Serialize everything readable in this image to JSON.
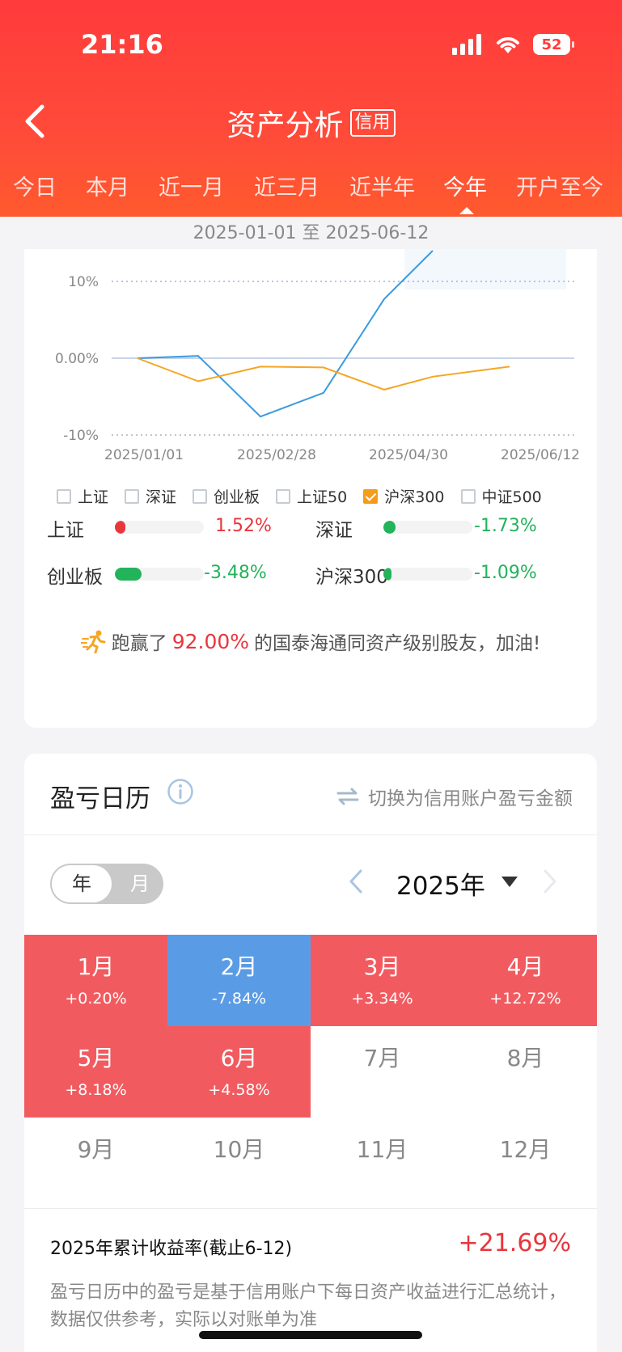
{
  "status": {
    "time": "21:16",
    "battery": "52"
  },
  "nav": {
    "title": "资产分析",
    "badge": "信用",
    "tabs": [
      "今日",
      "本月",
      "近一月",
      "近三月",
      "近半年",
      "今年",
      "开户至今"
    ],
    "active_tab": "今年"
  },
  "date_range": "2025-01-01 至 2025-06-12",
  "chart_data": {
    "type": "line",
    "x": [
      "2025/01/01",
      "2025/02/01",
      "2025/02/28",
      "2025/03/31",
      "2025/04/30",
      "2025/05/31",
      "2025/06/12"
    ],
    "x_tick_labels": [
      "2025/01/01",
      "2025/02/28",
      "2025/04/30",
      "2025/06/12"
    ],
    "y_tick_labels": [
      "10%",
      "0.00%",
      "-10%"
    ],
    "ylim": [
      -10,
      10
    ],
    "series": [
      {
        "color": "#3a9be0",
        "values": [
          0.0,
          0.3,
          -7.6,
          -4.5,
          7.7,
          14.0,
          null
        ]
      },
      {
        "color": "#f5a623",
        "values": [
          0.0,
          -3.0,
          -1.1,
          -1.2,
          -4.1,
          -2.4,
          -1.1
        ]
      }
    ],
    "grid": "dotted",
    "legend": [
      {
        "label": "上证",
        "checked": false
      },
      {
        "label": "深证",
        "checked": false
      },
      {
        "label": "创业板",
        "checked": false
      },
      {
        "label": "上证50",
        "checked": false
      },
      {
        "label": "沪深300",
        "checked": true
      },
      {
        "label": "中证500",
        "checked": false
      }
    ]
  },
  "indices": [
    {
      "name": "上证",
      "value": "1.52%",
      "pct": 12,
      "color": "#e8363d"
    },
    {
      "name": "深证",
      "value": "-1.73%",
      "pct": 14,
      "color": "#22b35b"
    },
    {
      "name": "创业板",
      "value": "-3.48%",
      "pct": 30,
      "color": "#22b35b"
    },
    {
      "name": "沪深300",
      "value": "-1.09%",
      "pct": 9,
      "color": "#22b35b"
    }
  ],
  "beat": {
    "prefix": "跑赢了",
    "pct": "92.00%",
    "suffix": "的国泰海通同资产级别股友，加油!"
  },
  "calendar": {
    "title": "盈亏日历",
    "switch_label": "切换为信用账户盈亏金额",
    "seg_year": "年",
    "seg_month": "月",
    "year": "2025年",
    "months": [
      {
        "name": "1月",
        "value": "+0.20%",
        "state": "pos"
      },
      {
        "name": "2月",
        "value": "-7.84%",
        "state": "neg"
      },
      {
        "name": "3月",
        "value": "+3.34%",
        "state": "pos"
      },
      {
        "name": "4月",
        "value": "+12.72%",
        "state": "pos"
      },
      {
        "name": "5月",
        "value": "+8.18%",
        "state": "pos"
      },
      {
        "name": "6月",
        "value": "+4.58%",
        "state": "pos"
      },
      {
        "name": "7月",
        "value": "",
        "state": "none"
      },
      {
        "name": "8月",
        "value": "",
        "state": "none"
      },
      {
        "name": "9月",
        "value": "",
        "state": "none"
      },
      {
        "name": "10月",
        "value": "",
        "state": "none"
      },
      {
        "name": "11月",
        "value": "",
        "state": "none"
      },
      {
        "name": "12月",
        "value": "",
        "state": "none"
      }
    ],
    "cumulative_label": "2025年累计收益率(截止6-12)",
    "cumulative_value": "+21.69%",
    "note": "盈亏日历中的盈亏是基于信用账户下每日资产收益进行汇总统计，数据仅供参考，实际以对账单为准"
  }
}
